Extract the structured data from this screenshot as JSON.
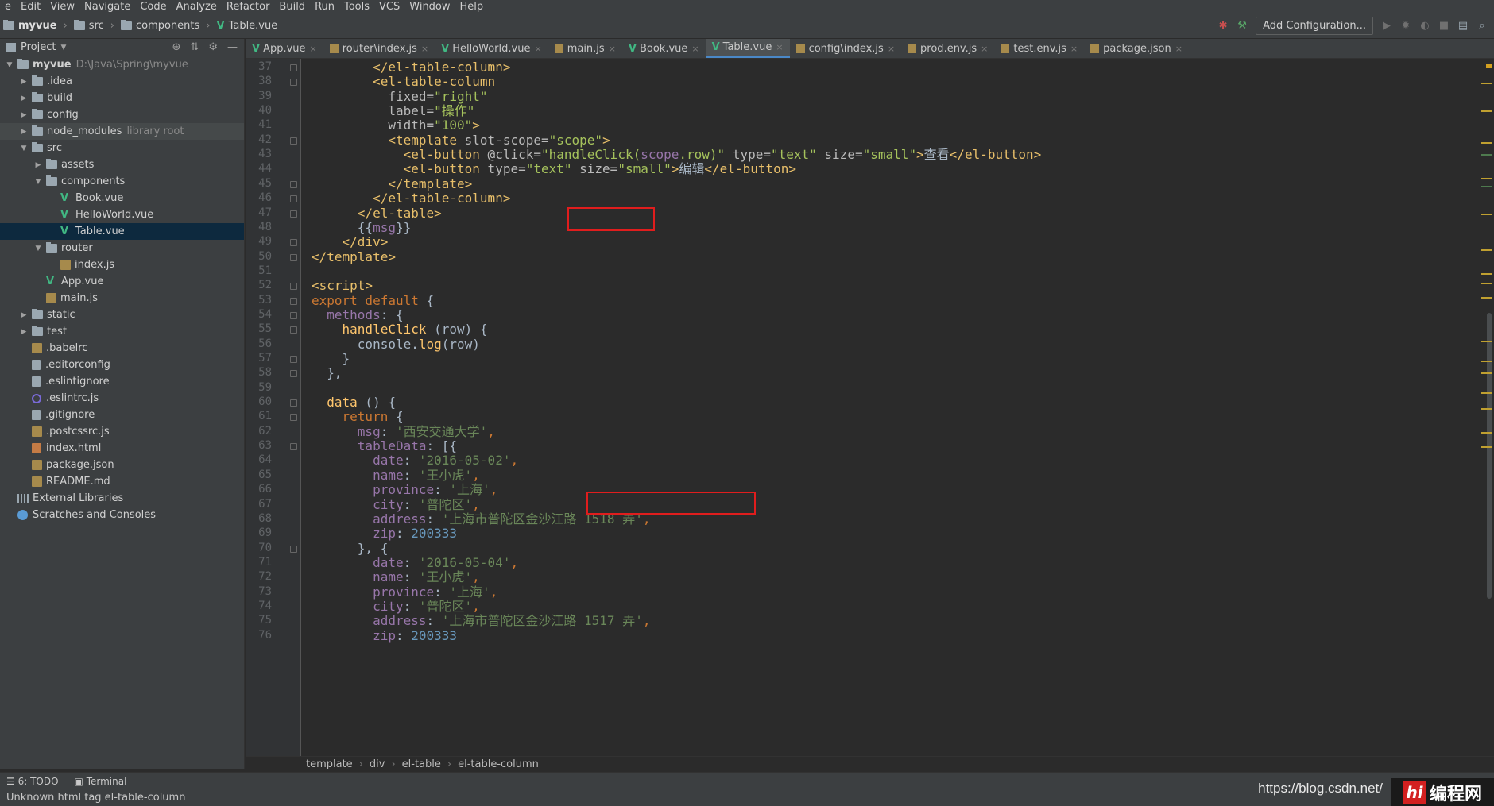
{
  "menu": [
    "e",
    "Edit",
    "View",
    "Navigate",
    "Code",
    "Analyze",
    "Refactor",
    "Build",
    "Run",
    "Tools",
    "VCS",
    "Window",
    "Help"
  ],
  "nav": {
    "project": "myvue",
    "crumbs": [
      "src",
      "components",
      "Table.vue"
    ],
    "add_config": "Add Configuration..."
  },
  "project_panel": {
    "title": "Project",
    "tree": [
      {
        "label": "myvue",
        "hint": "D:\\Java\\Spring\\myvue",
        "icon": "folder",
        "depth": 0,
        "arrow": "open"
      },
      {
        "label": ".idea",
        "icon": "folder",
        "depth": 1,
        "arrow": "closed"
      },
      {
        "label": "build",
        "icon": "folder",
        "depth": 1,
        "arrow": "closed"
      },
      {
        "label": "config",
        "icon": "folder",
        "depth": 1,
        "arrow": "closed"
      },
      {
        "label": "node_modules",
        "hint": "library root",
        "icon": "folder",
        "depth": 1,
        "arrow": "closed",
        "library": true
      },
      {
        "label": "src",
        "icon": "folder",
        "depth": 1,
        "arrow": "open"
      },
      {
        "label": "assets",
        "icon": "folder",
        "depth": 2,
        "arrow": "closed"
      },
      {
        "label": "components",
        "icon": "folder",
        "depth": 2,
        "arrow": "open"
      },
      {
        "label": "Book.vue",
        "icon": "vue",
        "depth": 3
      },
      {
        "label": "HelloWorld.vue",
        "icon": "vue",
        "depth": 3
      },
      {
        "label": "Table.vue",
        "icon": "vue",
        "depth": 3,
        "selected": true
      },
      {
        "label": "router",
        "icon": "folder",
        "depth": 2,
        "arrow": "open"
      },
      {
        "label": "index.js",
        "icon": "js",
        "depth": 3
      },
      {
        "label": "App.vue",
        "icon": "vue",
        "depth": 2
      },
      {
        "label": "main.js",
        "icon": "js",
        "depth": 2
      },
      {
        "label": "static",
        "icon": "folder",
        "depth": 1,
        "arrow": "closed"
      },
      {
        "label": "test",
        "icon": "folder",
        "depth": 1,
        "arrow": "closed"
      },
      {
        "label": ".babelrc",
        "icon": "js",
        "depth": 1
      },
      {
        "label": ".editorconfig",
        "icon": "file",
        "depth": 1
      },
      {
        "label": ".eslintignore",
        "icon": "file",
        "depth": 1
      },
      {
        "label": ".eslintrc.js",
        "icon": "eslint",
        "depth": 1
      },
      {
        "label": ".gitignore",
        "icon": "file",
        "depth": 1
      },
      {
        "label": ".postcssrc.js",
        "icon": "js",
        "depth": 1
      },
      {
        "label": "index.html",
        "icon": "html",
        "depth": 1
      },
      {
        "label": "package.json",
        "icon": "js",
        "depth": 1
      },
      {
        "label": "README.md",
        "icon": "js",
        "depth": 1
      },
      {
        "label": "External Libraries",
        "icon": "lib",
        "depth": 0
      },
      {
        "label": "Scratches and Consoles",
        "icon": "scratch",
        "depth": 0
      }
    ]
  },
  "tabs": [
    {
      "label": "App.vue",
      "icon": "vue"
    },
    {
      "label": "router\\index.js",
      "icon": "js"
    },
    {
      "label": "HelloWorld.vue",
      "icon": "vue"
    },
    {
      "label": "main.js",
      "icon": "js"
    },
    {
      "label": "Book.vue",
      "icon": "vue"
    },
    {
      "label": "Table.vue",
      "icon": "vue",
      "active": true
    },
    {
      "label": "config\\index.js",
      "icon": "js"
    },
    {
      "label": "prod.env.js",
      "icon": "js"
    },
    {
      "label": "test.env.js",
      "icon": "js"
    },
    {
      "label": "package.json",
      "icon": "js"
    }
  ],
  "editor": {
    "first_line": 37,
    "lines": [
      [
        [
          "        ",
          ""
        ],
        [
          "</el-table-column>",
          "tag"
        ]
      ],
      [
        [
          "        ",
          ""
        ],
        [
          "<el-table-column",
          "tag"
        ]
      ],
      [
        [
          "          fixed=",
          "attr"
        ],
        [
          "\"right\"",
          "str"
        ]
      ],
      [
        [
          "          label=",
          "attr"
        ],
        [
          "\"操作\"",
          "str"
        ]
      ],
      [
        [
          "          width=",
          "attr"
        ],
        [
          "\"100\"",
          "str"
        ],
        [
          ">",
          "tag"
        ]
      ],
      [
        [
          "          ",
          ""
        ],
        [
          "<template ",
          "tag"
        ],
        [
          "slot-scope",
          "attr"
        ],
        [
          "=",
          "attr"
        ],
        [
          "\"scope\"",
          "str"
        ],
        [
          ">",
          "tag"
        ]
      ],
      [
        [
          "            ",
          ""
        ],
        [
          "<el-button",
          "tag"
        ],
        [
          " @click=",
          "attr"
        ],
        [
          "\"handleClick(",
          "str"
        ],
        [
          "scope",
          "prop"
        ],
        [
          ".row)\"",
          "str"
        ],
        [
          " type=",
          "attr"
        ],
        [
          "\"text\"",
          "str"
        ],
        [
          " size=",
          "attr"
        ],
        [
          "\"small\"",
          "str"
        ],
        [
          ">",
          "tag"
        ],
        [
          "查看",
          ""
        ],
        [
          "</el-button>",
          "tag"
        ]
      ],
      [
        [
          "            ",
          ""
        ],
        [
          "<el-button",
          "tag"
        ],
        [
          " type=",
          "attr"
        ],
        [
          "\"text\"",
          "str"
        ],
        [
          " size=",
          "attr"
        ],
        [
          "\"small\"",
          "str"
        ],
        [
          ">",
          "tag"
        ],
        [
          "编辑",
          ""
        ],
        [
          "</el-button>",
          "tag"
        ]
      ],
      [
        [
          "          ",
          ""
        ],
        [
          "</template>",
          "tag"
        ]
      ],
      [
        [
          "        ",
          ""
        ],
        [
          "</el-table-column>",
          "tag"
        ]
      ],
      [
        [
          "      ",
          ""
        ],
        [
          "</el-table>",
          "tag"
        ]
      ],
      [
        [
          "      {{",
          ""
        ],
        [
          "msg",
          "prop"
        ],
        [
          "}}",
          ""
        ]
      ],
      [
        [
          "    ",
          ""
        ],
        [
          "</div>",
          "tag"
        ]
      ],
      [
        [
          "",
          ""
        ],
        [
          "</template>",
          "tag"
        ]
      ],
      [
        [
          "",
          ""
        ]
      ],
      [
        [
          "",
          ""
        ],
        [
          "<script>",
          "tag"
        ]
      ],
      [
        [
          "",
          ""
        ],
        [
          "export default",
          "kw"
        ],
        [
          " {",
          ""
        ]
      ],
      [
        [
          "  ",
          ""
        ],
        [
          "methods",
          "prop"
        ],
        [
          ": {",
          ""
        ]
      ],
      [
        [
          "    ",
          ""
        ],
        [
          "handleClick",
          "fn"
        ],
        [
          " (row) {",
          ""
        ]
      ],
      [
        [
          "      console.",
          ""
        ],
        [
          "log",
          "fn"
        ],
        [
          "(row)",
          ""
        ]
      ],
      [
        [
          "    }",
          ""
        ]
      ],
      [
        [
          "  },",
          ""
        ]
      ],
      [
        [
          "",
          ""
        ]
      ],
      [
        [
          "  ",
          ""
        ],
        [
          "data",
          "fn"
        ],
        [
          " () {",
          ""
        ]
      ],
      [
        [
          "    ",
          ""
        ],
        [
          "return",
          "kw"
        ],
        [
          " {",
          ""
        ]
      ],
      [
        [
          "      ",
          ""
        ],
        [
          "msg",
          "prop"
        ],
        [
          ": ",
          ""
        ],
        [
          "'西安交通大学'",
          "strz"
        ],
        [
          ",",
          "kw"
        ]
      ],
      [
        [
          "      ",
          ""
        ],
        [
          "tableData",
          "prop"
        ],
        [
          ": [{",
          ""
        ]
      ],
      [
        [
          "        ",
          ""
        ],
        [
          "date",
          "prop"
        ],
        [
          ": ",
          ""
        ],
        [
          "'2016-05-02'",
          "strz"
        ],
        [
          ",",
          "kw"
        ]
      ],
      [
        [
          "        ",
          ""
        ],
        [
          "name",
          "prop"
        ],
        [
          ": ",
          ""
        ],
        [
          "'王小虎'",
          "strz"
        ],
        [
          ",",
          "kw"
        ]
      ],
      [
        [
          "        ",
          ""
        ],
        [
          "province",
          "prop"
        ],
        [
          ": ",
          ""
        ],
        [
          "'上海'",
          "strz"
        ],
        [
          ",",
          "kw"
        ]
      ],
      [
        [
          "        ",
          ""
        ],
        [
          "city",
          "prop"
        ],
        [
          ": ",
          ""
        ],
        [
          "'普陀区'",
          "strz"
        ],
        [
          ",",
          "kw"
        ]
      ],
      [
        [
          "        ",
          ""
        ],
        [
          "address",
          "prop"
        ],
        [
          ": ",
          ""
        ],
        [
          "'上海市普陀区金沙江路 1518 弄'",
          "strz"
        ],
        [
          ",",
          "kw"
        ]
      ],
      [
        [
          "        ",
          ""
        ],
        [
          "zip",
          "prop"
        ],
        [
          ": ",
          ""
        ],
        [
          "200333",
          "num"
        ]
      ],
      [
        [
          "      }, {",
          ""
        ]
      ],
      [
        [
          "        ",
          ""
        ],
        [
          "date",
          "prop"
        ],
        [
          ": ",
          ""
        ],
        [
          "'2016-05-04'",
          "strz"
        ],
        [
          ",",
          "kw"
        ]
      ],
      [
        [
          "        ",
          ""
        ],
        [
          "name",
          "prop"
        ],
        [
          ": ",
          ""
        ],
        [
          "'王小虎'",
          "strz"
        ],
        [
          ",",
          "kw"
        ]
      ],
      [
        [
          "        ",
          ""
        ],
        [
          "province",
          "prop"
        ],
        [
          ": ",
          ""
        ],
        [
          "'上海'",
          "strz"
        ],
        [
          ",",
          "kw"
        ]
      ],
      [
        [
          "        ",
          ""
        ],
        [
          "city",
          "prop"
        ],
        [
          ": ",
          ""
        ],
        [
          "'普陀区'",
          "strz"
        ],
        [
          ",",
          "kw"
        ]
      ],
      [
        [
          "        ",
          ""
        ],
        [
          "address",
          "prop"
        ],
        [
          ": ",
          ""
        ],
        [
          "'上海市普陀区金沙江路 1517 弄'",
          "strz"
        ],
        [
          ",",
          "kw"
        ]
      ],
      [
        [
          "        ",
          ""
        ],
        [
          "zip",
          "prop"
        ],
        [
          ": ",
          ""
        ],
        [
          "200333",
          "num"
        ]
      ]
    ]
  },
  "breadcrumb": [
    "template",
    "div",
    "el-table",
    "el-table-column"
  ],
  "bottom_tools": {
    "todo": "6: TODO",
    "terminal": "Terminal"
  },
  "status": "Unknown html tag el-table-column",
  "watermark": {
    "url": "https://blog.csdn.net/",
    "logo_h": "hi",
    "logo_text": "编程网"
  },
  "colors": {
    "accent": "#4a88c7",
    "highlight_box": "#e01d1d",
    "vue": "#41b883"
  }
}
